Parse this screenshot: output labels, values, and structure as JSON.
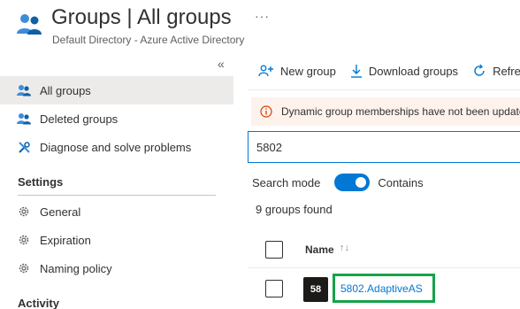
{
  "header": {
    "title": "Groups | All groups",
    "more_label": "···",
    "subtitle": "Default Directory - Azure Active Directory"
  },
  "sidebar": {
    "collapse_label": "«",
    "items": [
      {
        "label": "All groups",
        "icon": "groups-icon",
        "active": true
      },
      {
        "label": "Deleted groups",
        "icon": "groups-icon",
        "active": false
      },
      {
        "label": "Diagnose and solve problems",
        "icon": "wrench-icon",
        "active": false
      }
    ],
    "settings_title": "Settings",
    "settings_items": [
      {
        "label": "General",
        "icon": "gear-icon"
      },
      {
        "label": "Expiration",
        "icon": "gear-icon"
      },
      {
        "label": "Naming policy",
        "icon": "gear-icon"
      }
    ],
    "activity_title": "Activity"
  },
  "toolbar": {
    "new_group_label": "New group",
    "download_label": "Download groups",
    "refresh_label": "Refresh"
  },
  "banner": {
    "text": "Dynamic group memberships have not been updated"
  },
  "search": {
    "value": "5802"
  },
  "search_mode": {
    "label": "Search mode",
    "value": "Contains",
    "enabled": true
  },
  "results": {
    "count_text": "9 groups found",
    "name_header": "Name",
    "rows": [
      {
        "avatar": "58",
        "name": "5802.AdaptiveAS"
      }
    ]
  },
  "colors": {
    "accent": "#0078d4",
    "highlight": "#16a34a",
    "banner_bg": "#fdf3ec",
    "warning": "#d83b01"
  }
}
